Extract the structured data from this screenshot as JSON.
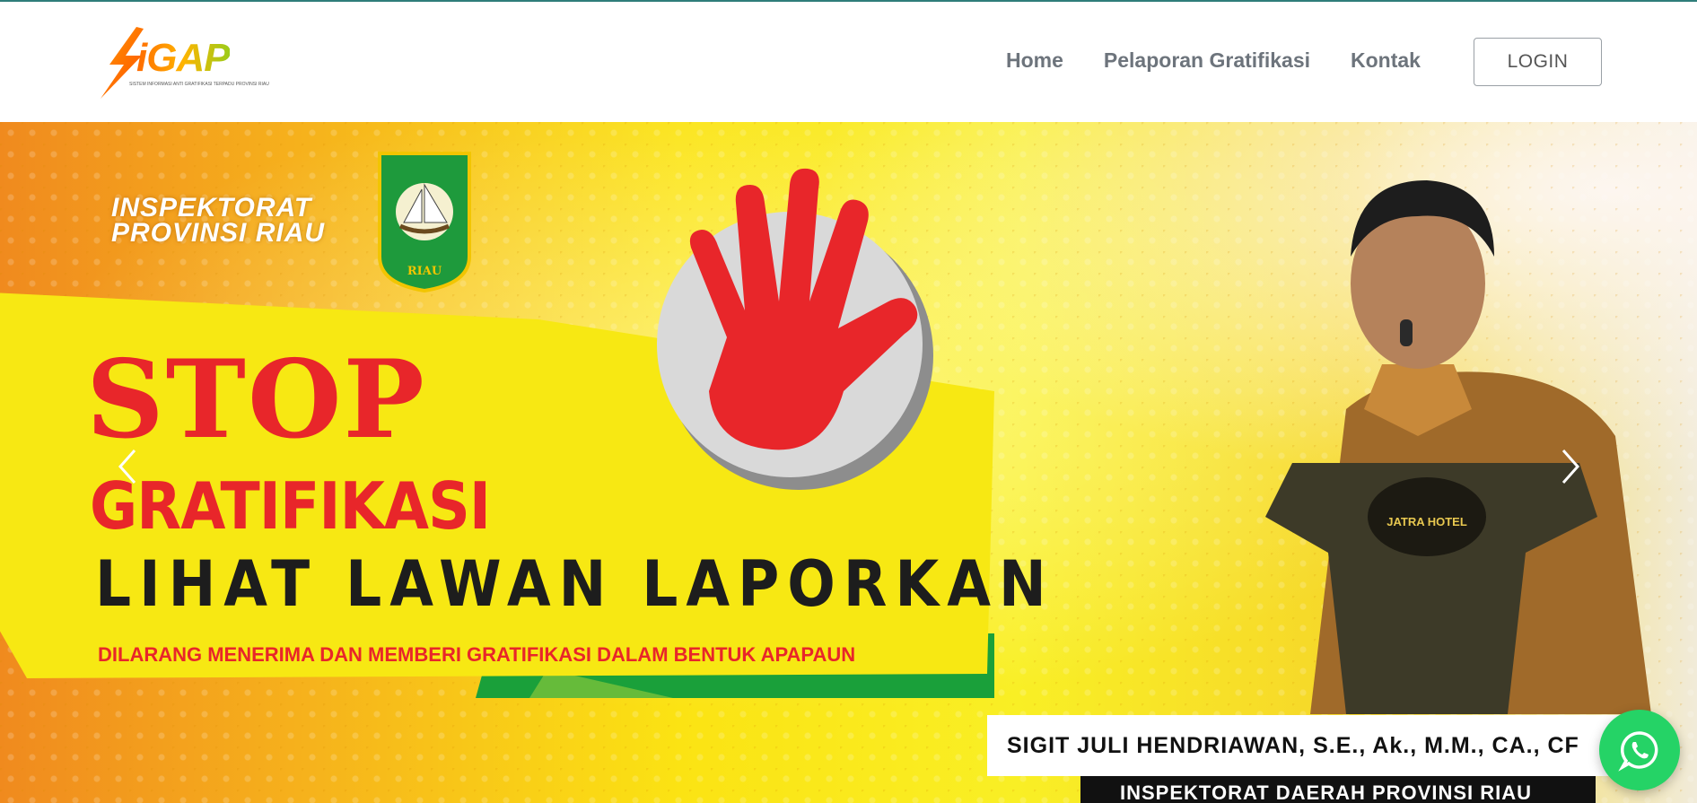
{
  "header": {
    "logo_text": "iGAP",
    "logo_tagline": "SISTEM INFORMASI ANTI GRATIFIKASI TERPADU PROVINSI RIAU",
    "nav": [
      {
        "label": "Home"
      },
      {
        "label": "Pelaporan Gratifikasi"
      },
      {
        "label": "Kontak"
      }
    ],
    "login_label": "LOGIN"
  },
  "hero": {
    "org_line1": "INSPEKTORAT",
    "org_line2": "PROVINSI RIAU",
    "emblem_label": "RIAU",
    "headline_stop": "STOP",
    "headline_gratifikasi": "GRATIFIKASI",
    "slogan": "LIHAT LAWAN LAPORKAN",
    "notice": "DILARANG MENERIMA DAN MEMBERI GRATIFIKASI DALAM BENTUK APAPAUN",
    "podium_text": "JATRA HOTEL",
    "person_name": "SIGIT JULI HENDRIAWAN, S.E., Ak., M.M., CA., CF",
    "person_title": "INSPEKTORAT DAERAH PROVINSI RIAU"
  },
  "colors": {
    "accent_red": "#e8262a",
    "banner_yellow": "#f7e813",
    "banner_green": "#1aa03a",
    "whatsapp_green": "#25d366",
    "nav_text": "#6d747c"
  },
  "icons": {
    "prev": "chevron-left-icon",
    "next": "chevron-right-icon",
    "chat": "whatsapp-icon"
  }
}
